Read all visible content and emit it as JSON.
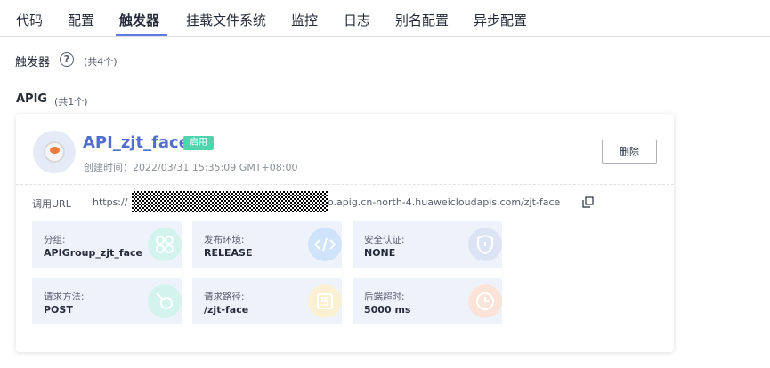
{
  "tabs": [
    {
      "label": "代码",
      "active": false
    },
    {
      "label": "配置",
      "active": false
    },
    {
      "label": "触发器",
      "active": true
    },
    {
      "label": "挂载文件系统",
      "active": false
    },
    {
      "label": "监控",
      "active": false
    },
    {
      "label": "日志",
      "active": false
    },
    {
      "label": "别名配置",
      "active": false
    },
    {
      "label": "异步配置",
      "active": false
    }
  ],
  "section": {
    "title": "触发器",
    "help_icon": "question-circle-icon",
    "count": "(共4个)"
  },
  "group": {
    "title": "APIG",
    "count": "(共1个)"
  },
  "trigger": {
    "name": "API_zjt_face",
    "status": "启用",
    "created": "创建时间：2022/03/31 15:35:09 GMT+08:00",
    "delete_label": "删除",
    "url_label": "调用URL",
    "url_prefix": "https://",
    "url_suffix": "o.apig.cn-north-4.huaweicloudapis.com/zjt-face",
    "copy_icon": "copy-icon",
    "details": [
      {
        "label": "分组:",
        "value": "APIGroup_zjt_face",
        "icon": "group-icon",
        "color": "#d3f4ec"
      },
      {
        "label": "发布环境:",
        "value": "RELEASE",
        "icon": "code-icon",
        "color": "#cfe3fb"
      },
      {
        "label": "安全认证:",
        "value": "NONE",
        "icon": "shield-icon",
        "color": "#dce3f5"
      },
      {
        "label": "请求方法:",
        "value": "POST",
        "icon": "method-icon",
        "color": "#d3f4ec"
      },
      {
        "label": "请求路径:",
        "value": "/zjt-face",
        "icon": "path-icon",
        "color": "#fbf1d2"
      },
      {
        "label": "后端超时:",
        "value": "5000 ms",
        "icon": "clock-icon",
        "color": "#fbe3d8"
      }
    ]
  },
  "colors": {
    "accent": "#5e7ce0",
    "link": "#526ecc",
    "status_badge": "#50d4ab"
  }
}
